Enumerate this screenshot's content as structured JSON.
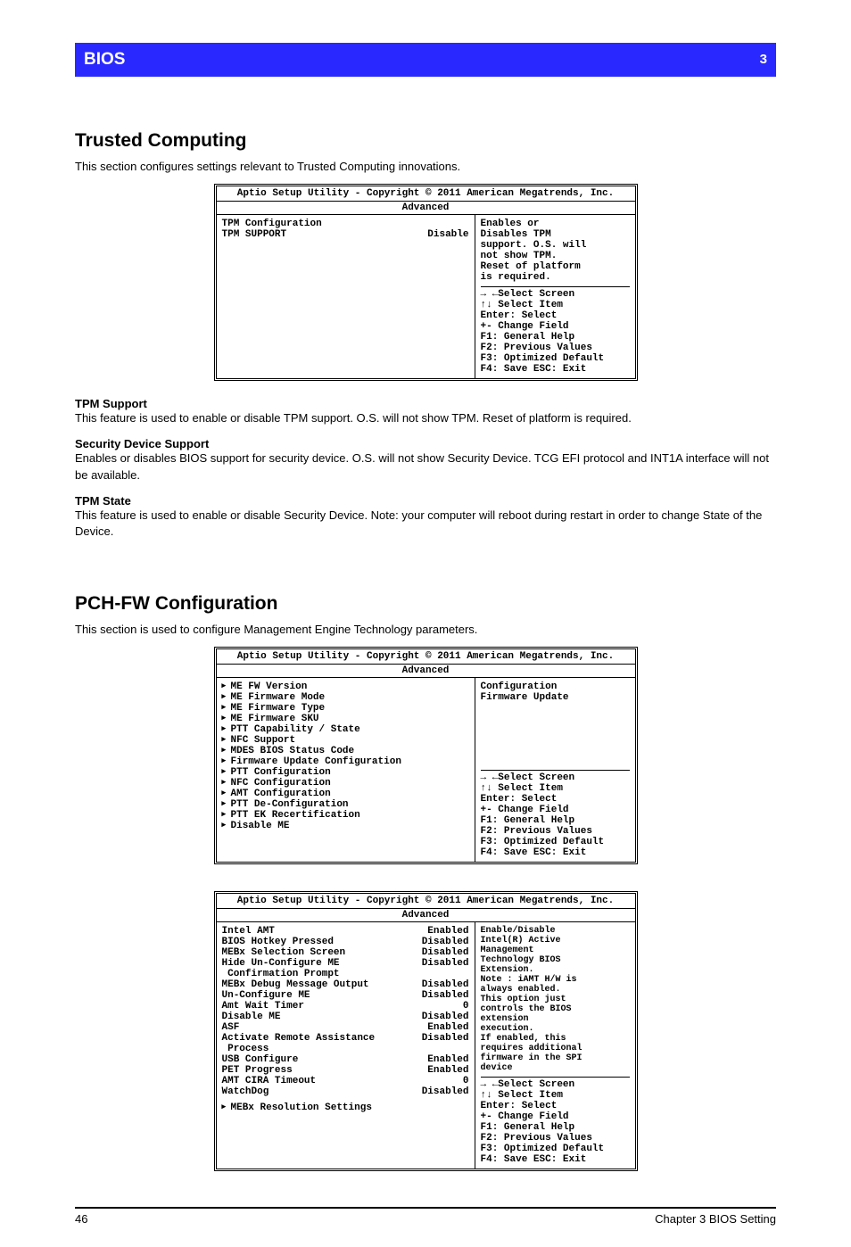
{
  "header": {
    "bar_title": "BIOS",
    "page_label": "3"
  },
  "sectionA": {
    "title": "Trusted Computing",
    "intro": "This section configures settings relevant to Trusted Computing innovations.",
    "panel": {
      "header_line1": "Aptio Setup Utility - Copyright © 2011 American Megatrends, Inc.",
      "header_line2": "Advanced",
      "rows": [
        {
          "label": "TPM Configuration",
          "value": ""
        },
        {
          "label": "TPM SUPPORT",
          "value": "Disable"
        }
      ],
      "help_top": "Enables or\nDisables TPM\nsupport. O.S. will\nnot show TPM.\nReset of platform\nis required.",
      "help_lines": [
        "→ ←Select Screen",
        "↑↓ Select Item",
        "Enter: Select",
        "+-  Change Field",
        "F1: General Help",
        "F2: Previous Values",
        "F3: Optimized Default",
        "F4: Save  ESC: Exit"
      ]
    },
    "fields": [
      {
        "label": "TPM Support",
        "desc": "This feature is used to enable or disable TPM support. O.S. will not show TPM. Reset of platform is required."
      },
      {
        "label": "Security Device Support",
        "desc": "Enables or disables BIOS support for security device. O.S. will not show Security Device. TCG EFI protocol and INT1A interface will not be available."
      },
      {
        "label": "TPM State",
        "desc": "This feature is used to enable or disable Security Device. Note: your computer will reboot during restart in order to change State of the Device."
      }
    ]
  },
  "sectionB": {
    "title": "PCH-FW Configuration",
    "intro": "This section is used to configure Management Engine Technology parameters.",
    "panel": {
      "rows": [
        "ME FW Version",
        "ME Firmware Mode",
        "ME Firmware Type",
        "ME Firmware SKU",
        "PTT Capability / State",
        "NFC Support",
        "MDES BIOS Status Code",
        "Firmware Update Configuration",
        "PTT Configuration",
        "NFC Configuration",
        "AMT Configuration",
        "PTT De-Configuration",
        "PTT EK Recertification",
        "Disable ME"
      ],
      "help_top": "Configuration\nFirmware Update",
      "help_lines": [
        "→ ←Select Screen",
        "↑↓ Select Item",
        "Enter: Select",
        "+-  Change Field",
        "F1: General Help",
        "F2: Previous Values",
        "F3: Optimized Default",
        "F4: Save  ESC: Exit"
      ]
    }
  },
  "sectionC": {
    "panel": {
      "rows": [
        {
          "label": "Intel AMT",
          "value": "Enabled"
        },
        {
          "label": "BIOS Hotkey Pressed",
          "value": "Disabled"
        },
        {
          "label": "MEBx Selection Screen",
          "value": "Disabled"
        },
        {
          "label": "Hide Un-Configure ME",
          "value": "Disabled"
        },
        {
          "label": " Confirmation Prompt",
          "value": ""
        },
        {
          "label": "MEBx Debug Message Output",
          "value": "Disabled"
        },
        {
          "label": "Un-Configure ME",
          "value": "Disabled"
        },
        {
          "label": "Amt Wait Timer",
          "value": "0"
        },
        {
          "label": "Disable ME",
          "value": "Disabled"
        },
        {
          "label": "ASF",
          "value": "Enabled"
        },
        {
          "label": "Activate Remote Assistance",
          "value": "Disabled"
        },
        {
          "label": " Process",
          "value": ""
        },
        {
          "label": "USB Configure",
          "value": "Enabled"
        },
        {
          "label": "PET Progress",
          "value": "Enabled"
        },
        {
          "label": "AMT CIRA Timeout",
          "value": "0"
        },
        {
          "label": "WatchDog",
          "value": "Disabled"
        }
      ],
      "footer_item": "MEBx Resolution Settings",
      "help_top": "Enable/Disable\nIntel(R) Active\nManagement\nTechnology BIOS\nExtension.\nNote : iAMT H/W is\nalways enabled.\nThis option just\ncontrols the BIOS\nextension\nexecution.\nIf enabled, this\nrequires additional\nfirmware in the SPI\ndevice",
      "help_lines": [
        "→ ←Select Screen",
        "↑↓ Select Item",
        "Enter: Select",
        "+-  Change Field",
        "F1: General Help",
        "F2: Previous Values",
        "F3: Optimized Default",
        "F4: Save  ESC: Exit"
      ]
    }
  },
  "footer": {
    "left": "46",
    "right": "Chapter 3 BIOS Setting"
  }
}
